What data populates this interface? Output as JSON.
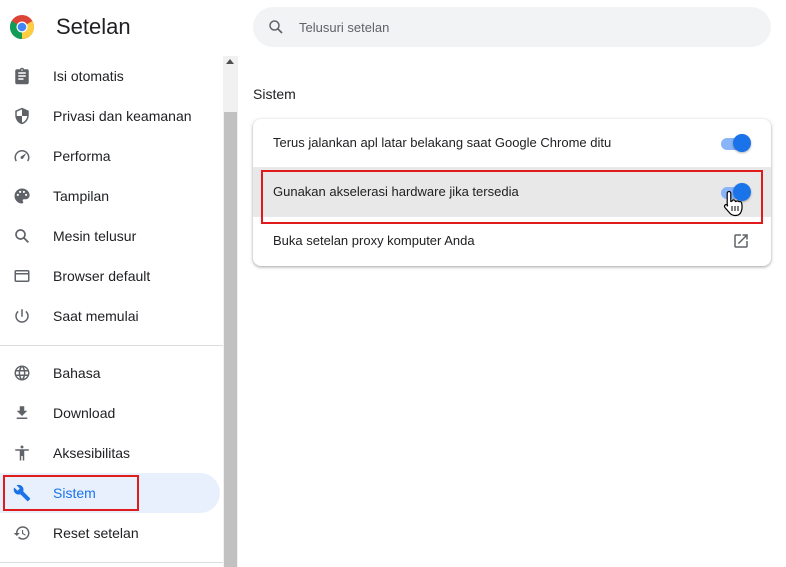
{
  "header": {
    "title": "Setelan",
    "logo_icon": "chrome-logo-icon",
    "search": {
      "placeholder": "Telusuri setelan",
      "value": "",
      "icon": "search-icon"
    }
  },
  "sidebar": {
    "items": [
      {
        "label": "Isi otomatis",
        "icon": "clipboard-icon",
        "active": false
      },
      {
        "label": "Privasi dan keamanan",
        "icon": "shield-icon",
        "active": false
      },
      {
        "label": "Performa",
        "icon": "speedometer-icon",
        "active": false
      },
      {
        "label": "Tampilan",
        "icon": "palette-icon",
        "active": false
      },
      {
        "label": "Mesin telusur",
        "icon": "search-icon",
        "active": false
      },
      {
        "label": "Browser default",
        "icon": "browser-icon",
        "active": false
      },
      {
        "label": "Saat memulai",
        "icon": "power-icon",
        "active": false
      },
      {
        "label": "Bahasa",
        "icon": "globe-icon",
        "active": false
      },
      {
        "label": "Download",
        "icon": "download-icon",
        "active": false
      },
      {
        "label": "Aksesibilitas",
        "icon": "accessibility-icon",
        "active": false
      },
      {
        "label": "Sistem",
        "icon": "wrench-icon",
        "active": true
      },
      {
        "label": "Reset setelan",
        "icon": "history-icon",
        "active": false
      }
    ]
  },
  "main": {
    "section_title": "Sistem",
    "rows": [
      {
        "label": "Terus jalankan apl latar belakang saat Google Chrome ditu",
        "control": "toggle",
        "checked": true
      },
      {
        "label": "Gunakan akselerasi hardware jika tersedia",
        "control": "toggle",
        "checked": true
      },
      {
        "label": "Buka setelan proxy komputer Anda",
        "control": "external-link-icon"
      }
    ]
  },
  "colors": {
    "accent": "#1a73e8",
    "accent_light": "#8ab4f8",
    "active_bg": "#e8f0fe",
    "highlight_box": "#e01b1b",
    "icon_gray": "#5f6368"
  }
}
